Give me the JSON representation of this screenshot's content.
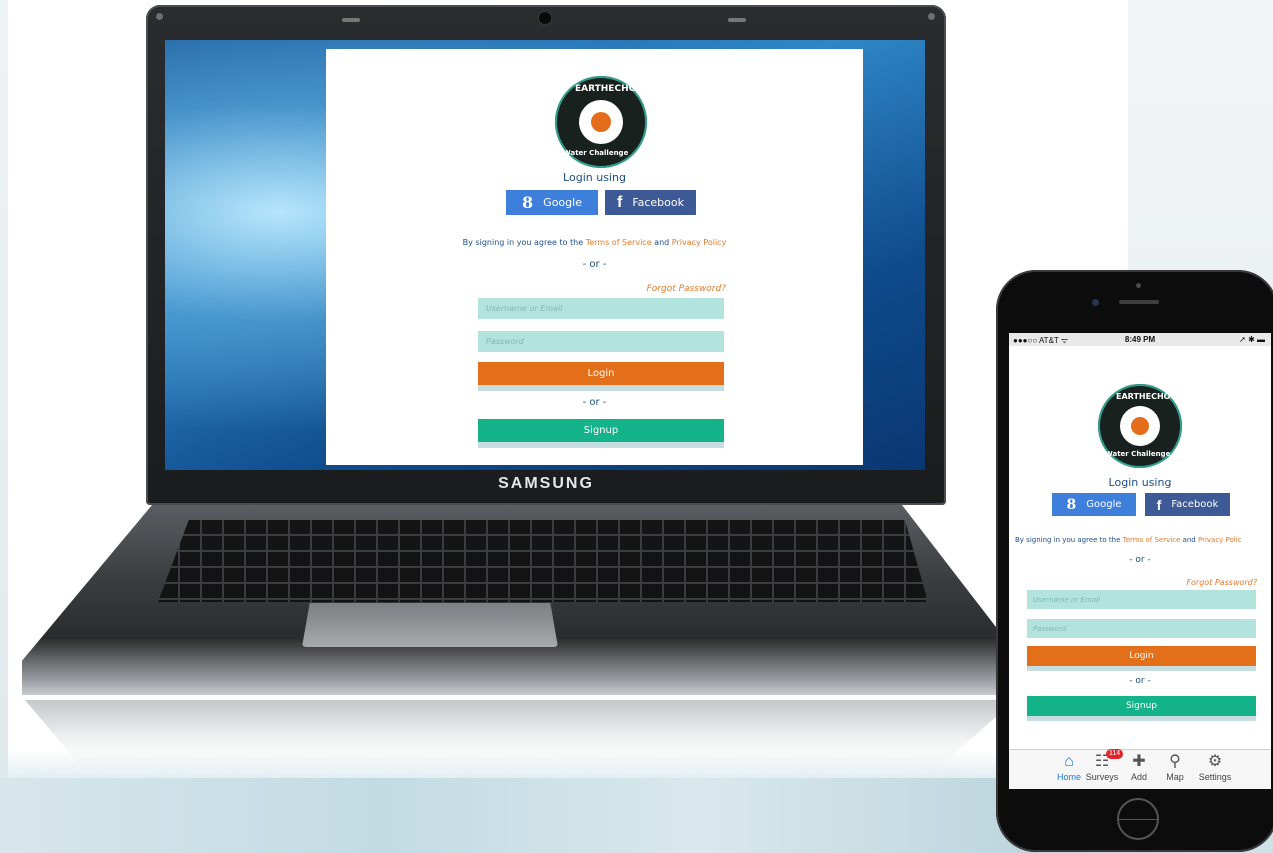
{
  "login": {
    "logo_top": "EARTHECHO",
    "logo_bottom": "Water Challenge",
    "login_using": "Login using",
    "google_label": "Google",
    "google_icon": "8",
    "facebook_label": "Facebook",
    "facebook_icon": "f",
    "agree_prefix": "By signing in you agree to the",
    "terms_link": "Terms of Service",
    "agree_and": "and",
    "privacy_link": "Privacy Policy",
    "or_text": "- or -",
    "forgot_password": "Forgot Password?",
    "username_placeholder": "Username or Email",
    "password_placeholder": "Password",
    "login_button": "Login",
    "signup_button": "Signup"
  },
  "laptop": {
    "brand": "SAMSUNG"
  },
  "phone": {
    "carrier": "●●●○○ AT&T ᯤ",
    "time": "8:49 PM",
    "battery": "➚ ✱ ▬",
    "privacy_link_truncated": "Privacy Polic",
    "tabs": [
      {
        "label": "Home",
        "icon": "home-icon",
        "active": true
      },
      {
        "label": "Surveys",
        "icon": "surveys-icon",
        "badge": "114"
      },
      {
        "label": "Add",
        "icon": "plus-icon"
      },
      {
        "label": "Map",
        "icon": "map-pin-icon"
      },
      {
        "label": "Settings",
        "icon": "gear-icon"
      }
    ]
  },
  "colors": {
    "accent_orange": "#e36f1a",
    "signup_green": "#14b38a",
    "field_teal": "#b3e3dd",
    "google_blue": "#3f7fdc",
    "facebook_blue": "#3d5a96",
    "text_navy": "#1b4e8a"
  }
}
